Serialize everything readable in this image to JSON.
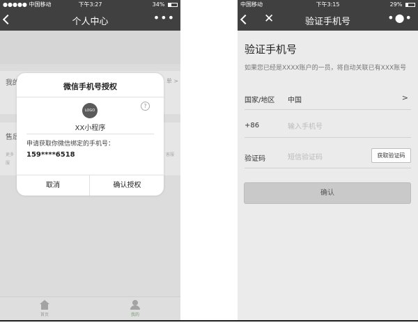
{
  "left_phone": {
    "status": {
      "carrier": "●●●●● 中国移动",
      "time": "下午3:27",
      "battery_text": "34%",
      "battery_level": 0.34
    },
    "nav": {
      "title": "个人中心",
      "more": "•••"
    },
    "list": {
      "row1_label": "我的",
      "row1_right": "单 >",
      "row2_label": "售后",
      "row2_note_left": "更多",
      "row2_note_right": "客服",
      "row2_note_second": "服"
    },
    "dialog": {
      "title": "微信手机号授权",
      "logo_text": "LOGO",
      "help_text": "?",
      "app_name": "XX小程序",
      "request_text": "申请获取你微信绑定的手机号：",
      "phone": "159****6518",
      "cancel_label": "取消",
      "confirm_label": "确认授权"
    },
    "tabbar": {
      "home_label": "首页",
      "mine_label": "我的"
    }
  },
  "right_phone": {
    "status": {
      "carrier": "中国移动",
      "time": "下午3:15",
      "battery_text": "29%",
      "battery_level": 0.29
    },
    "nav": {
      "title": "验证手机号",
      "more": "•●•"
    },
    "form": {
      "title": "验证手机号",
      "description": "如果您已经是XXXX账户的一员，将自动关联已有XXX账号",
      "country_label": "国家/地区",
      "country_value": "中国",
      "country_arrow": ">",
      "phone_prefix": "+86",
      "phone_placeholder": "输入手机号",
      "code_label": "验证码",
      "code_placeholder": "短信验证码",
      "get_code_label": "获取验证码",
      "confirm_label": "确认"
    }
  },
  "colors": {
    "nav_bg": "#404040",
    "overlay_bg": "#e2e2e2",
    "confirm_disabled": "#c9c9c9"
  }
}
